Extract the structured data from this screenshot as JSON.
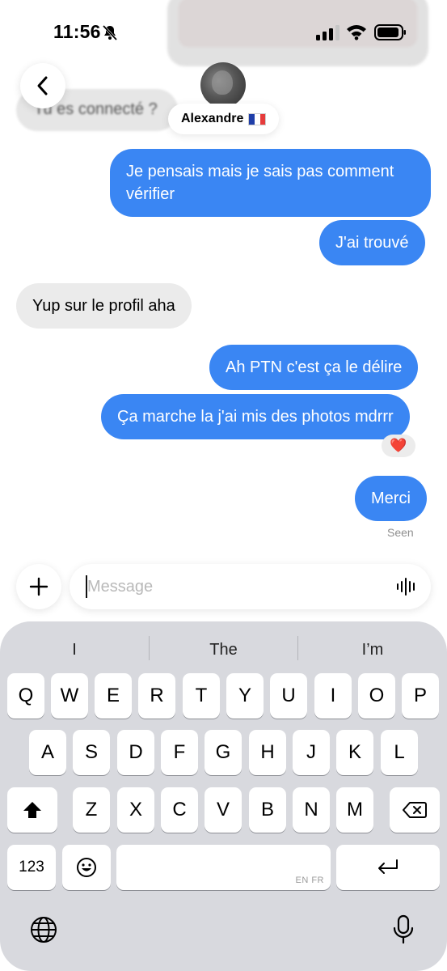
{
  "status_bar": {
    "time": "11:56"
  },
  "header": {
    "back_icon": "chevron-left-icon",
    "contact_name": "Alexandre",
    "flag": "france-flag-icon",
    "previous_message": "Tu es connecté ?"
  },
  "messages": [
    {
      "direction": "out",
      "text": "Je pensais mais je sais pas comment vérifier"
    },
    {
      "direction": "out",
      "text": "J'ai trouvé"
    },
    {
      "direction": "in",
      "text": "Yup sur le profil aha"
    },
    {
      "direction": "out",
      "text": "Ah PTN c'est ça le délire"
    },
    {
      "direction": "out",
      "text": "Ça marche la j'ai mis des photos mdrrr",
      "reaction": "❤️"
    },
    {
      "direction": "out",
      "text": "Merci"
    }
  ],
  "seen_label": "Seen",
  "composer": {
    "placeholder": "Message",
    "value": "",
    "add_icon": "plus-icon",
    "voice_icon": "waveform-icon"
  },
  "keyboard": {
    "suggestions": [
      "I",
      "The",
      "I’m"
    ],
    "row1": [
      "Q",
      "W",
      "E",
      "R",
      "T",
      "Y",
      "U",
      "I",
      "O",
      "P"
    ],
    "row2": [
      "A",
      "S",
      "D",
      "F",
      "G",
      "H",
      "J",
      "K",
      "L"
    ],
    "row3": [
      "Z",
      "X",
      "C",
      "V",
      "B",
      "N",
      "M"
    ],
    "numbers_key": "123",
    "space_lang": "EN FR",
    "shift_icon": "shift-icon",
    "delete_icon": "backspace-icon",
    "emoji_icon": "emoji-icon",
    "return_icon": "return-icon",
    "globe_icon": "globe-icon",
    "mic_icon": "microphone-icon"
  },
  "colors": {
    "outgoing_bubble": "#3a86f3",
    "incoming_bubble": "#ebebeb",
    "keyboard_bg": "#d8d9de"
  }
}
